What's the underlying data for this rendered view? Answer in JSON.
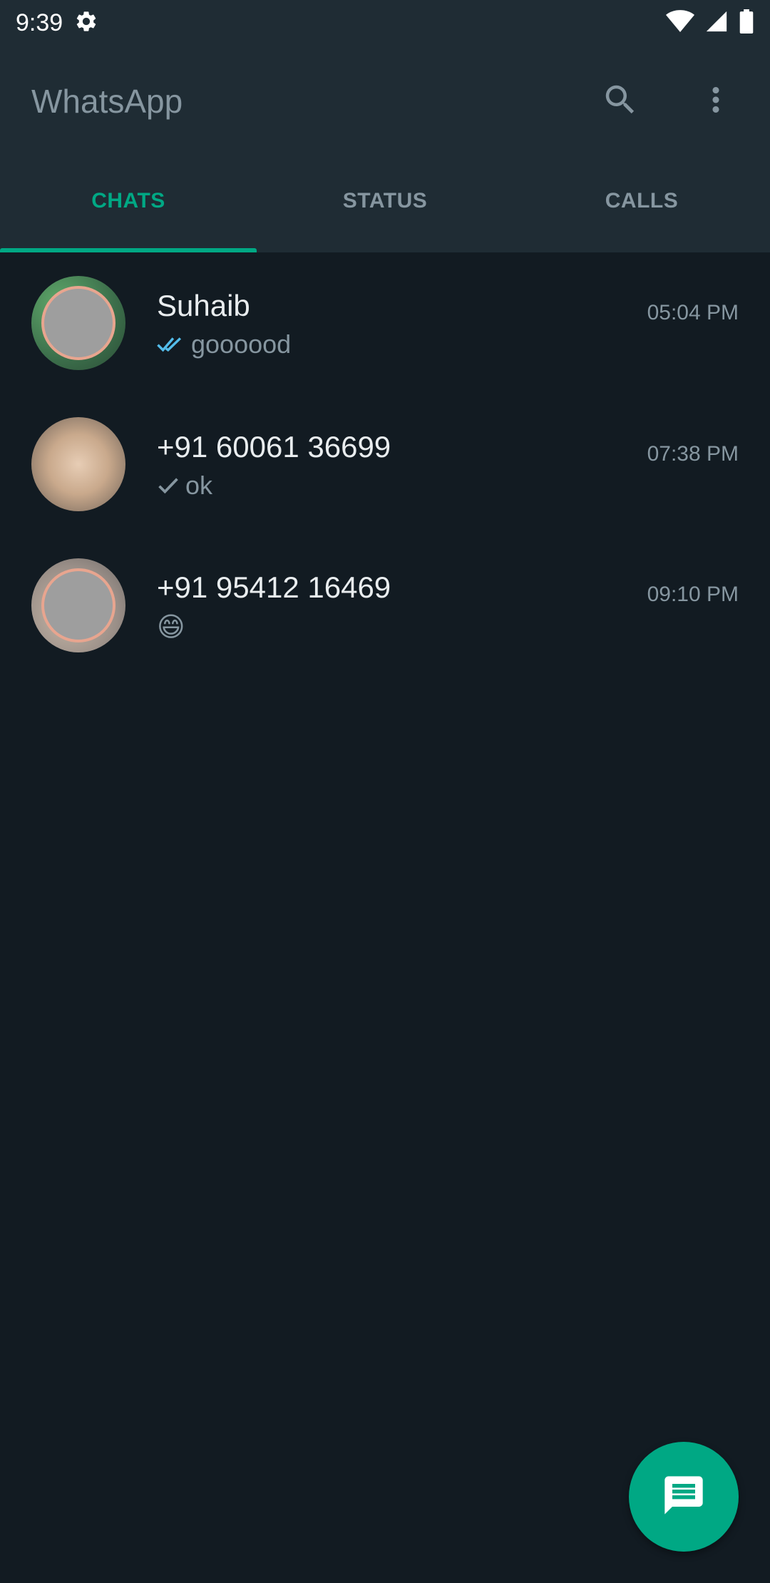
{
  "status_bar": {
    "time": "9:39",
    "icons": [
      "gear-icon",
      "wifi-icon",
      "signal-icon",
      "battery-icon"
    ]
  },
  "app_bar": {
    "title": "WhatsApp",
    "actions": [
      "search-icon",
      "more-vert-icon"
    ]
  },
  "tabs": [
    {
      "label": "CHATS",
      "active": true
    },
    {
      "label": "STATUS",
      "active": false
    },
    {
      "label": "CALLS",
      "active": false
    }
  ],
  "chats": [
    {
      "name": "Suhaib",
      "preview": "goooood",
      "time": "05:04 PM",
      "tick": "double-tick-read-icon"
    },
    {
      "name": "+91 60061 36699",
      "preview": "ok",
      "time": "07:38 PM",
      "tick": "single-tick-icon"
    },
    {
      "name": "+91 95412 16469",
      "preview": "😄",
      "time": "09:10 PM",
      "tick": ""
    }
  ],
  "fab": {
    "icon": "new-chat-icon"
  },
  "colors": {
    "accent": "#00a884",
    "header_bg": "#1f2c34",
    "list_bg": "#121b22",
    "read_tick": "#53bdeb",
    "muted_text": "#8696a0"
  }
}
